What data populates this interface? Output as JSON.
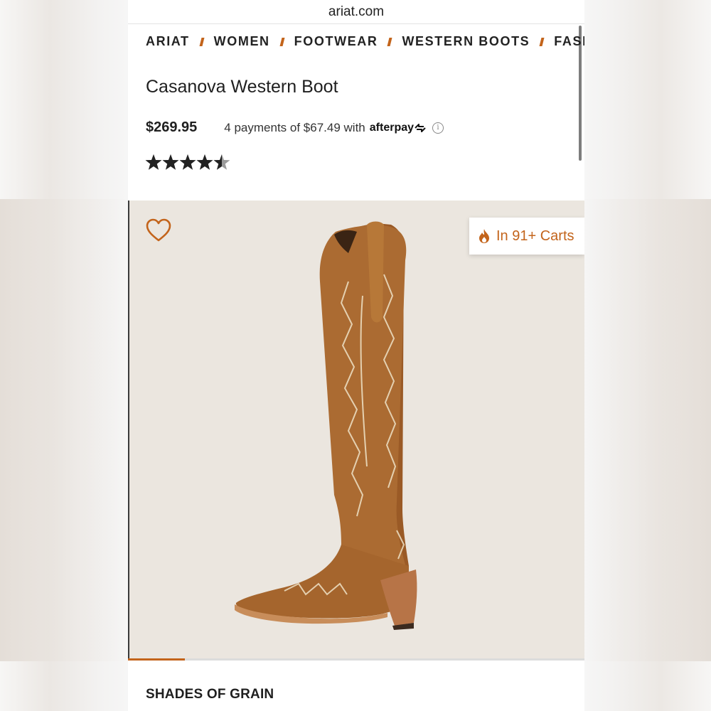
{
  "browser": {
    "url": "ariat.com"
  },
  "breadcrumb": [
    "ARIAT",
    "WOMEN",
    "FOOTWEAR",
    "WESTERN BOOTS",
    "FASH"
  ],
  "product": {
    "title": "Casanova Western Boot",
    "price": "$269.95",
    "afterpay_text": "4 payments of $67.49 with",
    "afterpay_brand": "afterpay",
    "rating": 4.5
  },
  "badge": {
    "carts_text": "In 91+ Carts"
  },
  "gallery": {
    "progress_fraction": 0.125
  },
  "section": {
    "heading": "SHADES OF GRAIN"
  },
  "colors": {
    "accent": "#c3641b",
    "boot": "#a96930",
    "background": "#ebe6df"
  },
  "icons": [
    "heart-icon",
    "flame-icon",
    "info-icon",
    "star-icon",
    "afterpay-loop-icon"
  ]
}
